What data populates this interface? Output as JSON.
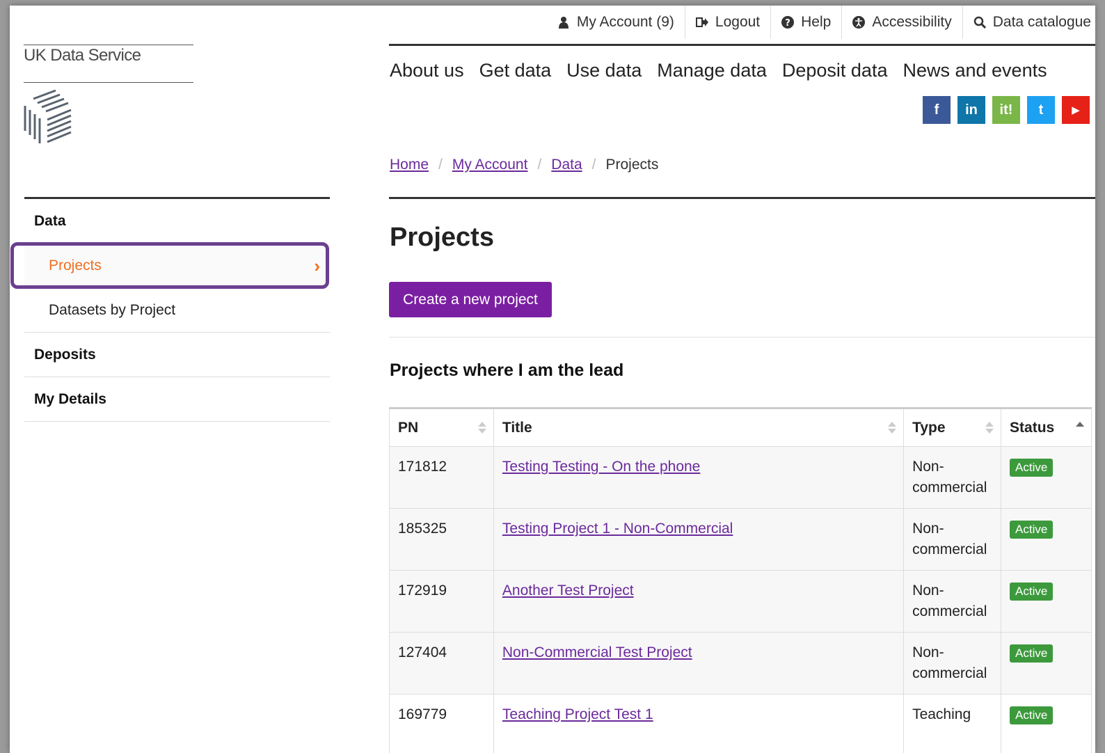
{
  "brand": {
    "name": "UK Data Service"
  },
  "utility": [
    {
      "label": "My Account (9)",
      "icon": "user-icon"
    },
    {
      "label": "Logout",
      "icon": "logout-icon"
    },
    {
      "label": "Help",
      "icon": "help-icon"
    },
    {
      "label": "Accessibility",
      "icon": "accessibility-icon"
    },
    {
      "label": "Data catalogue",
      "icon": "search-icon"
    }
  ],
  "main_nav": [
    "About us",
    "Get data",
    "Use data",
    "Manage data",
    "Deposit data",
    "News and events"
  ],
  "social": [
    {
      "label": "f",
      "color": "#3b5998"
    },
    {
      "label": "in",
      "color": "#0e76a8"
    },
    {
      "label": "it!",
      "color": "#7ab648"
    },
    {
      "label": "t",
      "color": "#1da1f2"
    },
    {
      "label": "▶",
      "color": "#e62117"
    }
  ],
  "breadcrumb": [
    "Home",
    "My Account",
    "Data",
    "Projects"
  ],
  "sidebar": {
    "sections": [
      {
        "heading": "Data",
        "items": [
          "Projects",
          "Datasets by Project"
        ]
      },
      {
        "heading": "Deposits"
      },
      {
        "heading": "My Details"
      }
    ]
  },
  "page": {
    "title": "Projects",
    "create_button": "Create a new project",
    "section_title": "Projects where I am the lead"
  },
  "table": {
    "columns": [
      "PN",
      "Title",
      "Type",
      "Status"
    ],
    "rows": [
      {
        "pn": "171812",
        "title": "Testing Testing - On the phone",
        "type": "Non-\ncommercial",
        "status": "Active"
      },
      {
        "pn": "185325",
        "title": "Testing Project 1 - Non-Commercial",
        "type": "Non-\ncommercial",
        "status": "Active"
      },
      {
        "pn": "172919",
        "title": "Another Test Project",
        "type": "Non-\ncommercial",
        "status": "Active"
      },
      {
        "pn": "127404",
        "title": "Non-Commercial Test Project",
        "type": "Non-\ncommercial",
        "status": "Active"
      },
      {
        "pn": "169779",
        "title": "Teaching Project Test 1",
        "type": "Teaching",
        "status": "Active"
      }
    ]
  },
  "colors": {
    "accent": "#7b1fa2",
    "active_sidebar": "#f26f21",
    "link": "#6b2a9c",
    "status_active": "#3c9a3c",
    "highlight": "#6b3f8f"
  }
}
